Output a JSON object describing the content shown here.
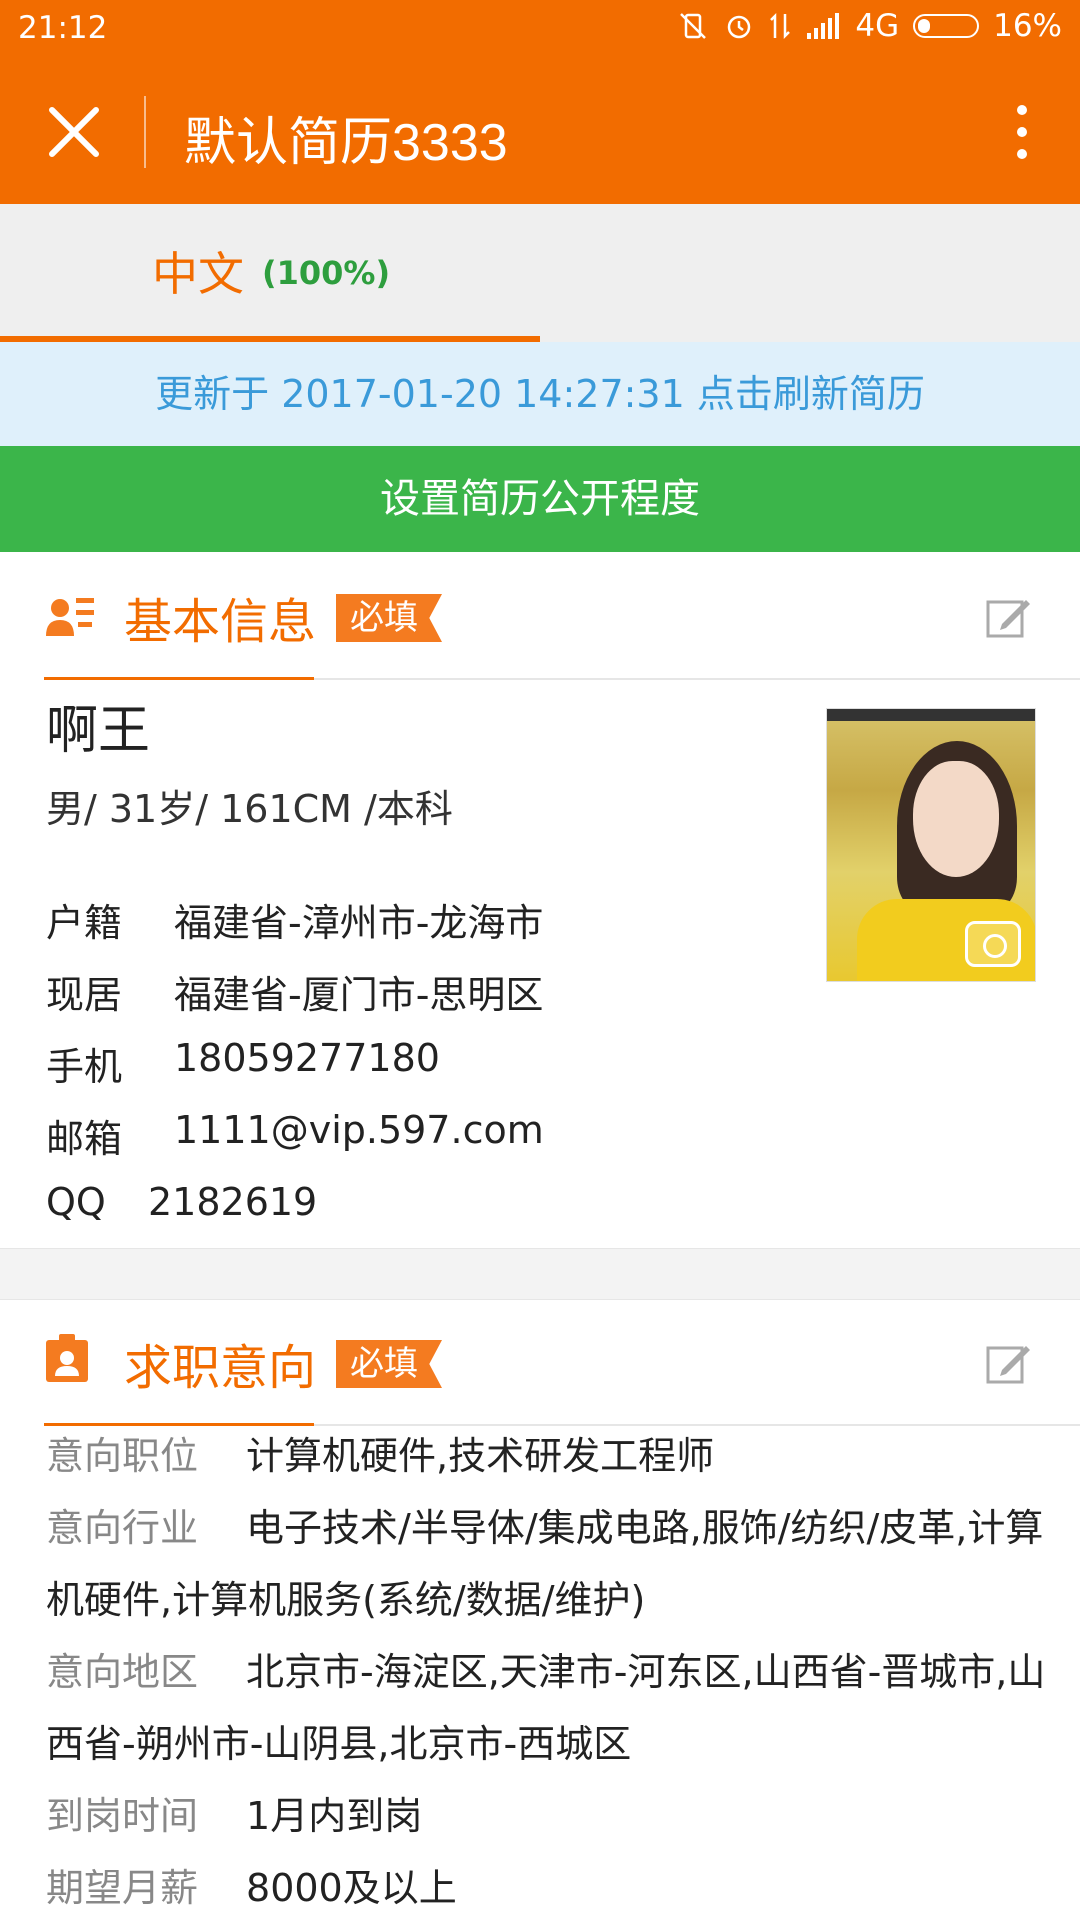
{
  "status_bar": {
    "time": "21:12",
    "network": "4G",
    "battery": "16%"
  },
  "toolbar": {
    "title": "默认简历3333"
  },
  "tabs": {
    "chinese_label": "中文",
    "chinese_percent": "(100%)"
  },
  "update_bar": "更新于 2017-01-20 14:27:31 点击刷新简历",
  "privacy_button": "设置简历公开程度",
  "basic": {
    "title": "基本信息",
    "badge": "必填",
    "name": "啊王",
    "meta": "男/ 31岁/ 161CM /本科",
    "rows": [
      {
        "key": "户籍",
        "value": "福建省-漳州市-龙海市"
      },
      {
        "key": "现居",
        "value": "福建省-厦门市-思明区"
      },
      {
        "key": "手机",
        "value": "18059277180"
      },
      {
        "key": "邮箱",
        "value": "1111@vip.597.com"
      },
      {
        "key": "QQ",
        "value": "2182619"
      }
    ]
  },
  "intent": {
    "title": "求职意向",
    "badge": "必填",
    "rows": [
      {
        "key": "意向职位",
        "value": "计算机硬件,技术研发工程师"
      },
      {
        "key": "意向行业",
        "value": "电子技术/半导体/集成电路,服饰/纺织/皮革,计算机硬件,计算机服务(系统/数据/维护)"
      },
      {
        "key": "意向地区",
        "value": "北京市-海淀区,天津市-河东区,山西省-晋城市,山西省-朔州市-山阴县,北京市-西城区"
      },
      {
        "key": "到岗时间",
        "value": "1月内到岗"
      },
      {
        "key": "期望月薪",
        "value": "8000及以上"
      }
    ]
  },
  "colors": {
    "brand_orange": "#f26c00",
    "green": "#3bb54a",
    "info_blue": "#3a9ad9"
  }
}
